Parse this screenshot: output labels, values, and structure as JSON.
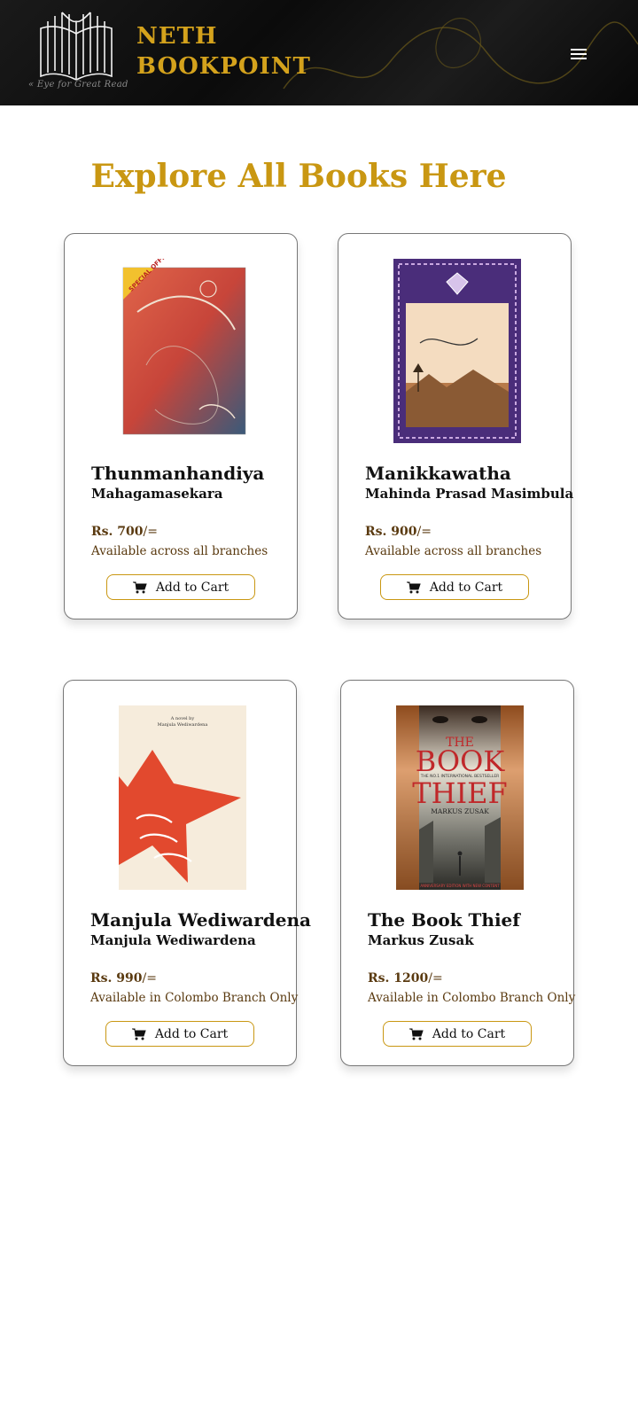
{
  "header": {
    "brand_line1": "NETH",
    "brand_line2": "BOOKPOINT",
    "tagline": "« Eye for Great Read",
    "menu_icon": "hamburger-menu-icon",
    "accent_color": "#d4a21c"
  },
  "main": {
    "title": "Explore All Books Here"
  },
  "books": [
    {
      "title": "Thunmanhandiya",
      "author": "Mahagamasekara",
      "price_label": "Rs. 700",
      "price_suffix": "/=",
      "availability": "Available across all branches",
      "button_label": "Add to Cart",
      "cover_badge": "SPECIAL OFFER"
    },
    {
      "title": "Manikkawatha",
      "author": "Mahinda Prasad Masimbula",
      "price_label": "Rs. 900",
      "price_suffix": "/=",
      "availability": "Available across all branches",
      "button_label": "Add to Cart"
    },
    {
      "title": "Manjula Wediwardena",
      "author": "Manjula Wediwardena",
      "price_label": "Rs. 990",
      "price_suffix": "/=",
      "availability": "Available in Colombo Branch Only",
      "button_label": "Add to Cart",
      "cover_top_text": "A novel by",
      "cover_author": "Manjula Wediwardena"
    },
    {
      "title": "The Book Thief",
      "author": "Markus Zusak",
      "price_label": "Rs. 1200",
      "price_suffix": "/=",
      "availability": "Available in Colombo Branch Only",
      "button_label": "Add to Cart",
      "cover_title_1": "THE",
      "cover_title_2": "BOOK",
      "cover_title_3": "THIEF",
      "cover_author": "MARKUS ZUSAK",
      "cover_tag": "THE NO.1 INTERNATIONAL BESTSELLER",
      "cover_footer": "ANNIVERSARY EDITION WITH NEW CONTENT"
    }
  ]
}
